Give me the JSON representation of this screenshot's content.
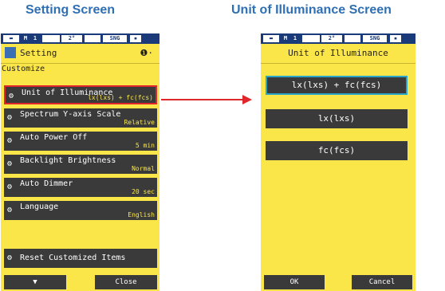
{
  "captions": {
    "left": "Setting Screen",
    "right": "Unit of Illuminance Screen"
  },
  "statusbar": {
    "mode": "M",
    "memory": "1",
    "angle": "2°",
    "mode2": "SNG"
  },
  "setting_screen": {
    "title": "Setting",
    "page_indicator": "❶·",
    "section": "Customize",
    "items": [
      {
        "label": "Unit of Illuminance",
        "value": "lx(lxs) + fc(fcs)",
        "selected": true
      },
      {
        "label": "Spectrum Y-axis Scale",
        "value": "Relative"
      },
      {
        "label": "Auto Power Off",
        "value": "5 min"
      },
      {
        "label": "Backlight Brightness",
        "value": "Normal"
      },
      {
        "label": "Auto Dimmer",
        "value": "20 sec"
      },
      {
        "label": "Language",
        "value": "English"
      }
    ],
    "reset_button": "Reset Customized Items",
    "down_button": "▼",
    "close_button": "Close"
  },
  "illuminance_screen": {
    "title": "Unit of Illuminance",
    "options": [
      {
        "label": "lx(lxs) + fc(fcs)",
        "selected": true
      },
      {
        "label": "lx(lxs)"
      },
      {
        "label": "fc(fcs)"
      }
    ],
    "ok_button": "OK",
    "cancel_button": "Cancel"
  },
  "colors": {
    "screen_bg": "#fbe64a",
    "item_bg": "#3a3a3a",
    "selection_red": "#e0262b",
    "selection_cyan": "#2aa7c8",
    "caption_blue": "#2f6fb3"
  }
}
